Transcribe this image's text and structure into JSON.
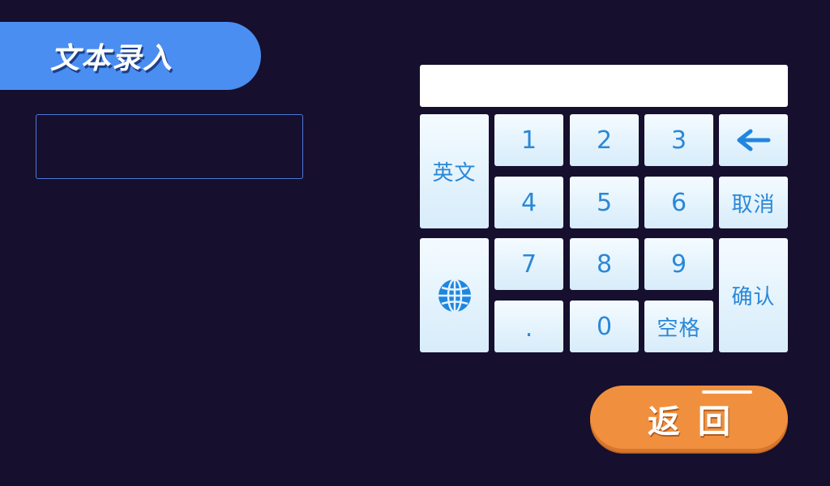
{
  "header": {
    "title": "文本录入"
  },
  "text_display": {
    "value": ""
  },
  "keypad": {
    "input_value": "",
    "keys": {
      "english": "英文",
      "k1": "1",
      "k2": "2",
      "k3": "3",
      "backspace_icon": "left-arrow-icon",
      "k4": "4",
      "k5": "5",
      "k6": "6",
      "cancel": "取消",
      "globe_icon": "globe-icon",
      "k7": "7",
      "k8": "8",
      "k9": "9",
      "confirm": "确认",
      "dot": ".",
      "k0": "0",
      "space": "空格"
    }
  },
  "footer": {
    "return_label": "返回"
  },
  "colors": {
    "background": "#160f2d",
    "title_pill": "#4a8ef2",
    "key_text": "#2a88d8",
    "return_button": "#f0903f"
  }
}
